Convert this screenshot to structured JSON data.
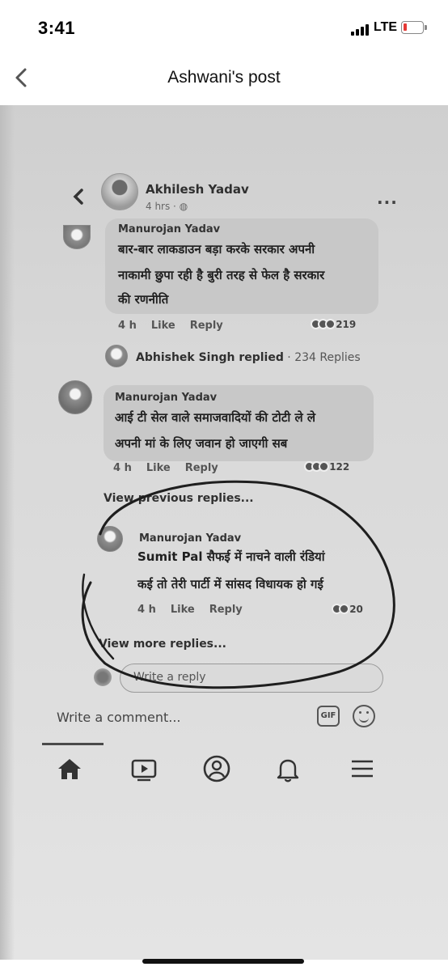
{
  "status_bar": {
    "time": "3:41",
    "network": "LTE",
    "battery_level_percent": 10,
    "battery_color": "#e53935"
  },
  "header": {
    "title": "Ashwani's post",
    "back_icon": "chevron-left-icon"
  },
  "photo": {
    "post": {
      "author": "Akhilesh Yadav",
      "time": "4 hrs · ",
      "more_icon": "more-dots-icon"
    },
    "comments": [
      {
        "author": "Manurojan Yadav",
        "text_lines": [
          "बार-बार लाकडाउन बड़ा करके सरकार अपनी",
          "नाकामी छुपा रही है बुरी तरह से फेल है सरकार",
          "की रणनीति"
        ],
        "time": "4 h",
        "like": "Like",
        "reply": "Reply",
        "reactions": "219"
      },
      {
        "author": "Manurojan Yadav",
        "text_lines": [
          "आई टी सेल वाले समाजवादियों की टोटी ले ले",
          "अपनी मां के लिए जवान हो जाएगी सब"
        ],
        "time": "4 h",
        "like": "Like",
        "reply": "Reply",
        "reactions": "122"
      }
    ],
    "replies_summary": {
      "name": "Abhishek Singh replied",
      "count": " · 234 Replies"
    },
    "view_previous": "View previous replies...",
    "reply": {
      "author": "Manurojan Yadav",
      "text_lines": [
        "Sumit Pal सैफई में नाचने वाली रंडियां",
        "कई तो तेरी पार्टी में सांसद विधायक हो गई"
      ],
      "time": "4 h",
      "like": "Like",
      "reply": "Reply",
      "reactions": "20"
    },
    "view_more": "View more replies...",
    "reply_placeholder": "Write a reply",
    "comment_placeholder": "Write a comment...",
    "gif_label": "GIF",
    "tabs": [
      "home-icon",
      "video-icon",
      "profile-icon",
      "bell-icon",
      "menu-icon"
    ]
  }
}
